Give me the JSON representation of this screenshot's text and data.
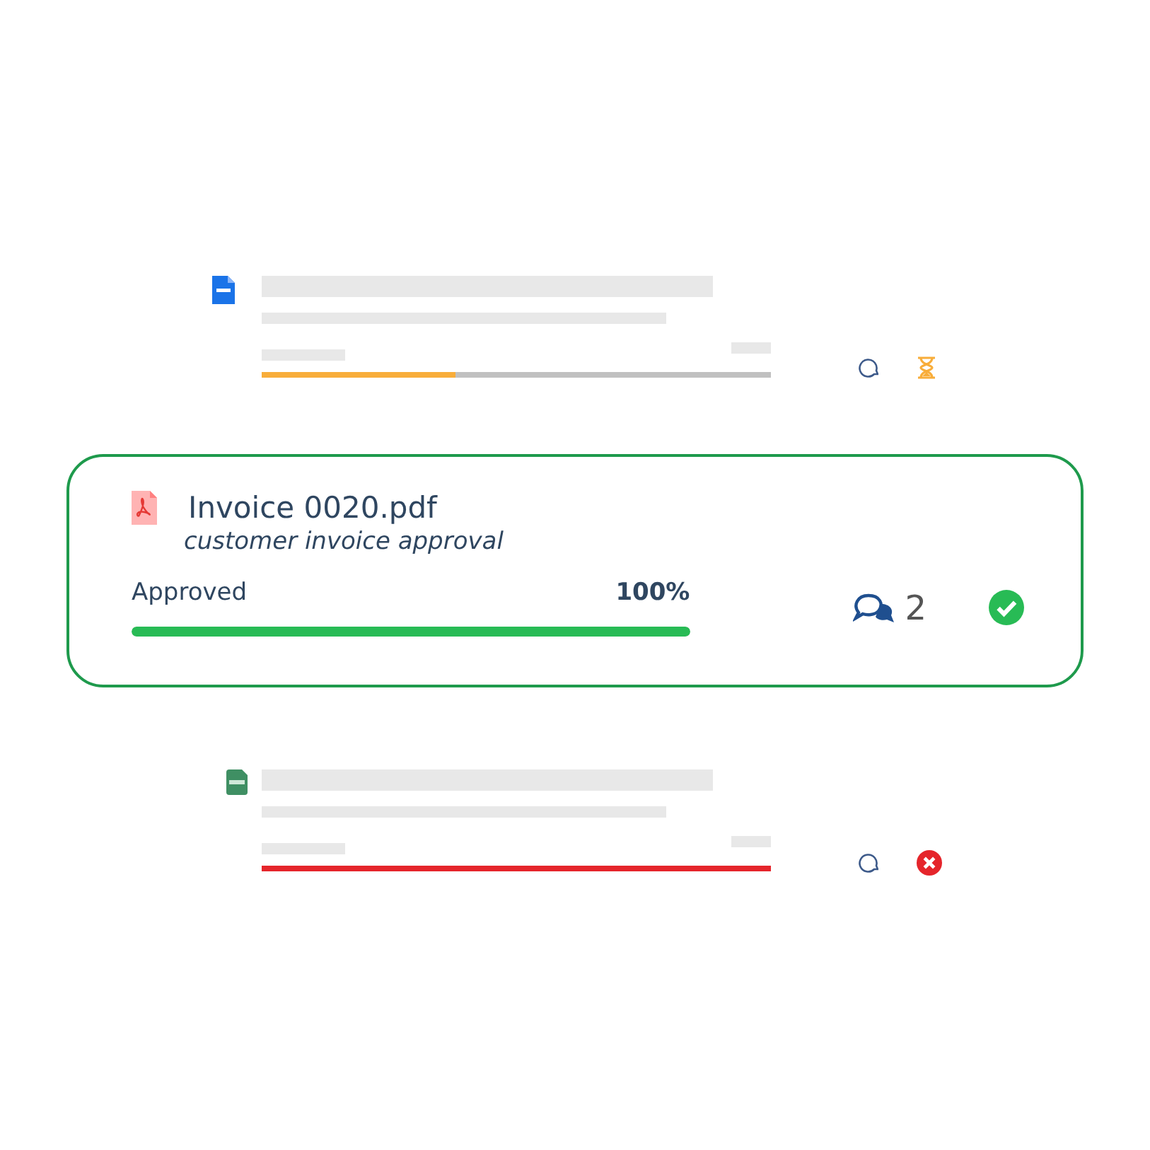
{
  "documents": [
    {
      "kind": "placeholder",
      "file_icon": {
        "kind": "doc"
      },
      "status_icon": {
        "kind": "pending"
      },
      "level": 0.38
    },
    {
      "kind": "detailed",
      "file_icon": {
        "kind": "pdf"
      },
      "title": "Invoice 0020.pdf",
      "description": "customer invoice approval",
      "status_label": "Approved",
      "percent": "100%",
      "level": 1,
      "comment_count": "2",
      "status_icon": {
        "kind": "approved"
      }
    },
    {
      "kind": "placeholder",
      "file_icon": {
        "kind": "xlsx"
      },
      "status_icon": {
        "kind": "rejected"
      },
      "level": 1
    }
  ]
}
